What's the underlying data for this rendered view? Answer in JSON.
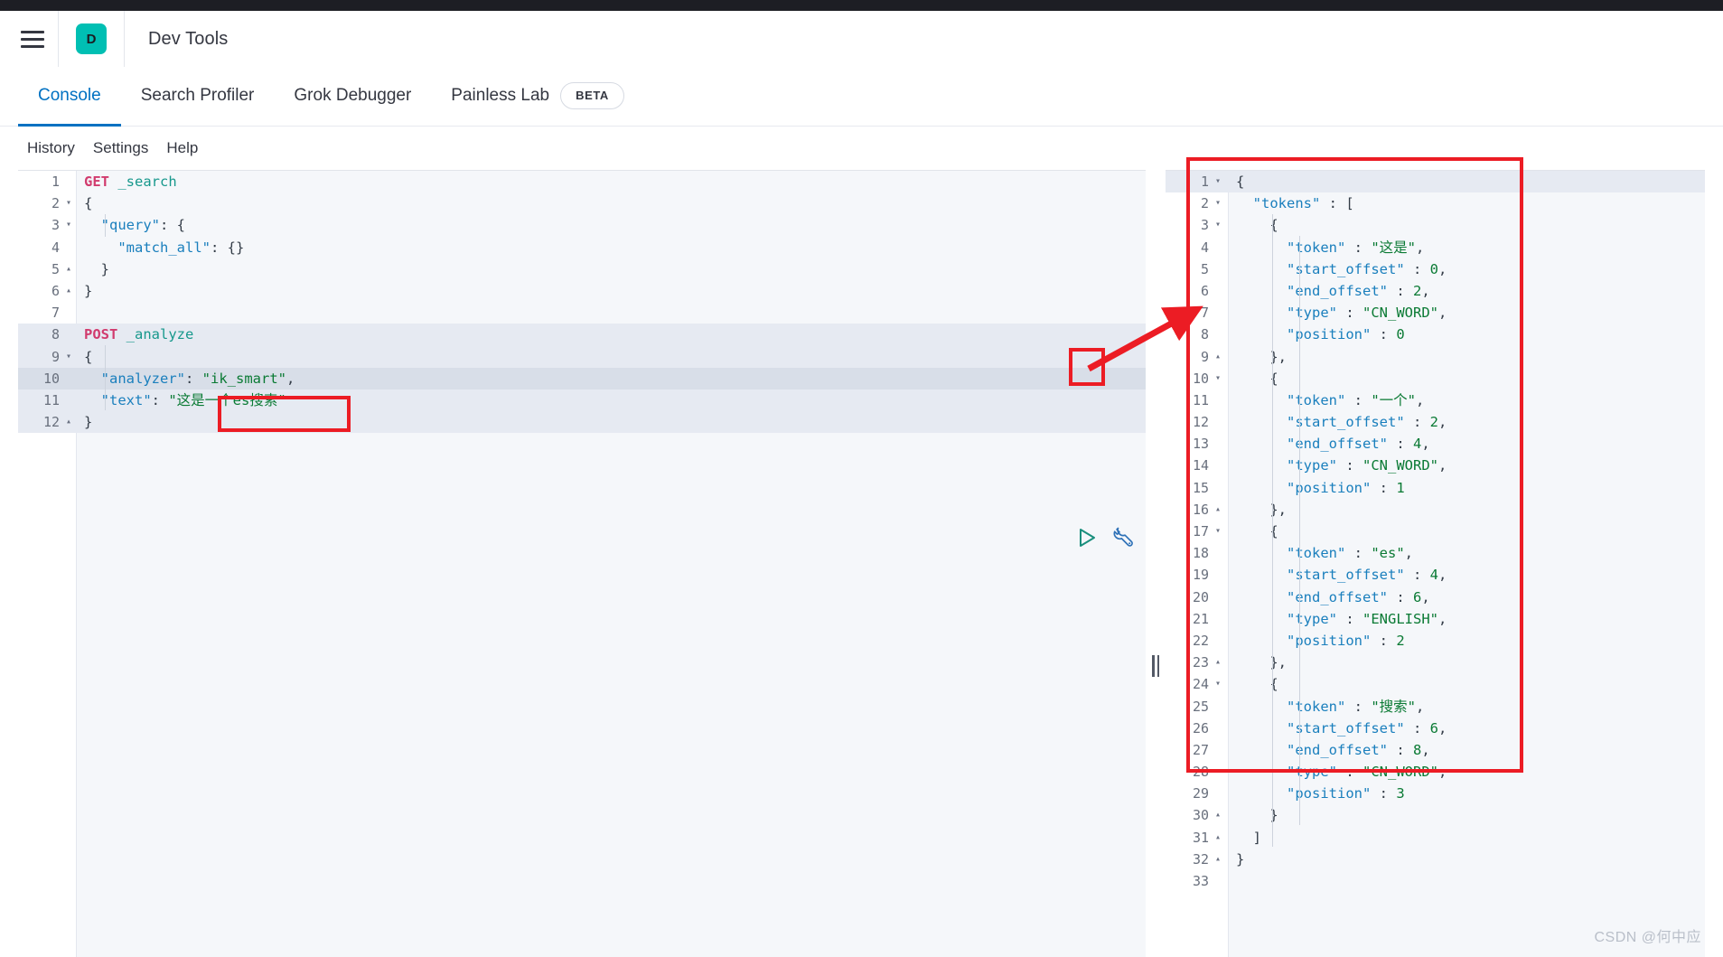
{
  "header": {
    "menu_icon": "hamburger-icon",
    "logo_letter": "D",
    "logo_color": "#00bfb3",
    "title": "Dev Tools"
  },
  "tabs": [
    {
      "label": "Console",
      "active": true
    },
    {
      "label": "Search Profiler",
      "active": false
    },
    {
      "label": "Grok Debugger",
      "active": false
    },
    {
      "label": "Painless Lab",
      "active": false,
      "badge": "BETA"
    }
  ],
  "submenu": [
    {
      "label": "History"
    },
    {
      "label": "Settings"
    },
    {
      "label": "Help"
    }
  ],
  "editor": {
    "run_icon": "play-icon",
    "wrench_icon": "wrench-icon",
    "lines": [
      {
        "n": "1",
        "fold": "",
        "selected": false,
        "current": false,
        "tokens": [
          {
            "t": "GET",
            "c": "k-method-get"
          },
          {
            "t": " ",
            "c": ""
          },
          {
            "t": "_search",
            "c": "k-url"
          }
        ]
      },
      {
        "n": "2",
        "fold": "▾",
        "selected": false,
        "current": false,
        "tokens": [
          {
            "t": "{",
            "c": "k-punct"
          }
        ]
      },
      {
        "n": "3",
        "fold": "▾",
        "selected": false,
        "current": false,
        "tokens": [
          {
            "t": "  ",
            "c": ""
          },
          {
            "t": "\"query\"",
            "c": "k-key"
          },
          {
            "t": ": {",
            "c": "k-punct"
          }
        ]
      },
      {
        "n": "4",
        "fold": "",
        "selected": false,
        "current": false,
        "tokens": [
          {
            "t": "    ",
            "c": ""
          },
          {
            "t": "\"match_all\"",
            "c": "k-key"
          },
          {
            "t": ": {}",
            "c": "k-punct"
          }
        ]
      },
      {
        "n": "5",
        "fold": "▴",
        "selected": false,
        "current": false,
        "tokens": [
          {
            "t": "  }",
            "c": "k-punct"
          }
        ]
      },
      {
        "n": "6",
        "fold": "▴",
        "selected": false,
        "current": false,
        "tokens": [
          {
            "t": "}",
            "c": "k-punct"
          }
        ]
      },
      {
        "n": "7",
        "fold": "",
        "selected": false,
        "current": false,
        "tokens": [
          {
            "t": "",
            "c": ""
          }
        ]
      },
      {
        "n": "8",
        "fold": "",
        "selected": true,
        "current": false,
        "tokens": [
          {
            "t": "POST",
            "c": "k-method-post"
          },
          {
            "t": " ",
            "c": ""
          },
          {
            "t": "_analyze",
            "c": "k-url"
          }
        ]
      },
      {
        "n": "9",
        "fold": "▾",
        "selected": true,
        "current": false,
        "tokens": [
          {
            "t": "{",
            "c": "k-punct"
          }
        ]
      },
      {
        "n": "10",
        "fold": "",
        "selected": true,
        "current": true,
        "tokens": [
          {
            "t": "  ",
            "c": ""
          },
          {
            "t": "\"analyzer\"",
            "c": "k-key"
          },
          {
            "t": ": ",
            "c": "k-punct"
          },
          {
            "t": "\"ik_smart\"",
            "c": "k-str"
          },
          {
            "t": ",",
            "c": "k-punct"
          }
        ]
      },
      {
        "n": "11",
        "fold": "",
        "selected": true,
        "current": false,
        "tokens": [
          {
            "t": "  ",
            "c": ""
          },
          {
            "t": "\"text\"",
            "c": "k-key"
          },
          {
            "t": ": ",
            "c": "k-punct"
          },
          {
            "t": "\"这是一个es搜索\"",
            "c": "k-str"
          }
        ]
      },
      {
        "n": "12",
        "fold": "▴",
        "selected": true,
        "current": false,
        "tokens": [
          {
            "t": "}",
            "c": "k-punct"
          }
        ]
      }
    ]
  },
  "output": {
    "lines": [
      {
        "n": "1",
        "fold": "▾",
        "first": true,
        "tokens": [
          {
            "t": "{",
            "c": "k-punct"
          }
        ]
      },
      {
        "n": "2",
        "fold": "▾",
        "first": false,
        "tokens": [
          {
            "t": "  ",
            "c": ""
          },
          {
            "t": "\"tokens\"",
            "c": "k-key"
          },
          {
            "t": " : [",
            "c": "k-punct"
          }
        ]
      },
      {
        "n": "3",
        "fold": "▾",
        "first": false,
        "tokens": [
          {
            "t": "    {",
            "c": "k-punct"
          }
        ]
      },
      {
        "n": "4",
        "fold": "",
        "first": false,
        "tokens": [
          {
            "t": "      ",
            "c": ""
          },
          {
            "t": "\"token\"",
            "c": "k-key"
          },
          {
            "t": " : ",
            "c": "k-punct"
          },
          {
            "t": "\"这是\"",
            "c": "k-str"
          },
          {
            "t": ",",
            "c": "k-punct"
          }
        ]
      },
      {
        "n": "5",
        "fold": "",
        "first": false,
        "tokens": [
          {
            "t": "      ",
            "c": ""
          },
          {
            "t": "\"start_offset\"",
            "c": "k-key"
          },
          {
            "t": " : ",
            "c": "k-punct"
          },
          {
            "t": "0",
            "c": "k-num"
          },
          {
            "t": ",",
            "c": "k-punct"
          }
        ]
      },
      {
        "n": "6",
        "fold": "",
        "first": false,
        "tokens": [
          {
            "t": "      ",
            "c": ""
          },
          {
            "t": "\"end_offset\"",
            "c": "k-key"
          },
          {
            "t": " : ",
            "c": "k-punct"
          },
          {
            "t": "2",
            "c": "k-num"
          },
          {
            "t": ",",
            "c": "k-punct"
          }
        ]
      },
      {
        "n": "7",
        "fold": "",
        "first": false,
        "tokens": [
          {
            "t": "      ",
            "c": ""
          },
          {
            "t": "\"type\"",
            "c": "k-key"
          },
          {
            "t": " : ",
            "c": "k-punct"
          },
          {
            "t": "\"CN_WORD\"",
            "c": "k-str"
          },
          {
            "t": ",",
            "c": "k-punct"
          }
        ]
      },
      {
        "n": "8",
        "fold": "",
        "first": false,
        "tokens": [
          {
            "t": "      ",
            "c": ""
          },
          {
            "t": "\"position\"",
            "c": "k-key"
          },
          {
            "t": " : ",
            "c": "k-punct"
          },
          {
            "t": "0",
            "c": "k-num"
          }
        ]
      },
      {
        "n": "9",
        "fold": "▴",
        "first": false,
        "tokens": [
          {
            "t": "    },",
            "c": "k-punct"
          }
        ]
      },
      {
        "n": "10",
        "fold": "▾",
        "first": false,
        "tokens": [
          {
            "t": "    {",
            "c": "k-punct"
          }
        ]
      },
      {
        "n": "11",
        "fold": "",
        "first": false,
        "tokens": [
          {
            "t": "      ",
            "c": ""
          },
          {
            "t": "\"token\"",
            "c": "k-key"
          },
          {
            "t": " : ",
            "c": "k-punct"
          },
          {
            "t": "\"一个\"",
            "c": "k-str"
          },
          {
            "t": ",",
            "c": "k-punct"
          }
        ]
      },
      {
        "n": "12",
        "fold": "",
        "first": false,
        "tokens": [
          {
            "t": "      ",
            "c": ""
          },
          {
            "t": "\"start_offset\"",
            "c": "k-key"
          },
          {
            "t": " : ",
            "c": "k-punct"
          },
          {
            "t": "2",
            "c": "k-num"
          },
          {
            "t": ",",
            "c": "k-punct"
          }
        ]
      },
      {
        "n": "13",
        "fold": "",
        "first": false,
        "tokens": [
          {
            "t": "      ",
            "c": ""
          },
          {
            "t": "\"end_offset\"",
            "c": "k-key"
          },
          {
            "t": " : ",
            "c": "k-punct"
          },
          {
            "t": "4",
            "c": "k-num"
          },
          {
            "t": ",",
            "c": "k-punct"
          }
        ]
      },
      {
        "n": "14",
        "fold": "",
        "first": false,
        "tokens": [
          {
            "t": "      ",
            "c": ""
          },
          {
            "t": "\"type\"",
            "c": "k-key"
          },
          {
            "t": " : ",
            "c": "k-punct"
          },
          {
            "t": "\"CN_WORD\"",
            "c": "k-str"
          },
          {
            "t": ",",
            "c": "k-punct"
          }
        ]
      },
      {
        "n": "15",
        "fold": "",
        "first": false,
        "tokens": [
          {
            "t": "      ",
            "c": ""
          },
          {
            "t": "\"position\"",
            "c": "k-key"
          },
          {
            "t": " : ",
            "c": "k-punct"
          },
          {
            "t": "1",
            "c": "k-num"
          }
        ]
      },
      {
        "n": "16",
        "fold": "▴",
        "first": false,
        "tokens": [
          {
            "t": "    },",
            "c": "k-punct"
          }
        ]
      },
      {
        "n": "17",
        "fold": "▾",
        "first": false,
        "tokens": [
          {
            "t": "    {",
            "c": "k-punct"
          }
        ]
      },
      {
        "n": "18",
        "fold": "",
        "first": false,
        "tokens": [
          {
            "t": "      ",
            "c": ""
          },
          {
            "t": "\"token\"",
            "c": "k-key"
          },
          {
            "t": " : ",
            "c": "k-punct"
          },
          {
            "t": "\"es\"",
            "c": "k-str"
          },
          {
            "t": ",",
            "c": "k-punct"
          }
        ]
      },
      {
        "n": "19",
        "fold": "",
        "first": false,
        "tokens": [
          {
            "t": "      ",
            "c": ""
          },
          {
            "t": "\"start_offset\"",
            "c": "k-key"
          },
          {
            "t": " : ",
            "c": "k-punct"
          },
          {
            "t": "4",
            "c": "k-num"
          },
          {
            "t": ",",
            "c": "k-punct"
          }
        ]
      },
      {
        "n": "20",
        "fold": "",
        "first": false,
        "tokens": [
          {
            "t": "      ",
            "c": ""
          },
          {
            "t": "\"end_offset\"",
            "c": "k-key"
          },
          {
            "t": " : ",
            "c": "k-punct"
          },
          {
            "t": "6",
            "c": "k-num"
          },
          {
            "t": ",",
            "c": "k-punct"
          }
        ]
      },
      {
        "n": "21",
        "fold": "",
        "first": false,
        "tokens": [
          {
            "t": "      ",
            "c": ""
          },
          {
            "t": "\"type\"",
            "c": "k-key"
          },
          {
            "t": " : ",
            "c": "k-punct"
          },
          {
            "t": "\"ENGLISH\"",
            "c": "k-str"
          },
          {
            "t": ",",
            "c": "k-punct"
          }
        ]
      },
      {
        "n": "22",
        "fold": "",
        "first": false,
        "tokens": [
          {
            "t": "      ",
            "c": ""
          },
          {
            "t": "\"position\"",
            "c": "k-key"
          },
          {
            "t": " : ",
            "c": "k-punct"
          },
          {
            "t": "2",
            "c": "k-num"
          }
        ]
      },
      {
        "n": "23",
        "fold": "▴",
        "first": false,
        "tokens": [
          {
            "t": "    },",
            "c": "k-punct"
          }
        ]
      },
      {
        "n": "24",
        "fold": "▾",
        "first": false,
        "tokens": [
          {
            "t": "    {",
            "c": "k-punct"
          }
        ]
      },
      {
        "n": "25",
        "fold": "",
        "first": false,
        "tokens": [
          {
            "t": "      ",
            "c": ""
          },
          {
            "t": "\"token\"",
            "c": "k-key"
          },
          {
            "t": " : ",
            "c": "k-punct"
          },
          {
            "t": "\"搜索\"",
            "c": "k-str"
          },
          {
            "t": ",",
            "c": "k-punct"
          }
        ]
      },
      {
        "n": "26",
        "fold": "",
        "first": false,
        "tokens": [
          {
            "t": "      ",
            "c": ""
          },
          {
            "t": "\"start_offset\"",
            "c": "k-key"
          },
          {
            "t": " : ",
            "c": "k-punct"
          },
          {
            "t": "6",
            "c": "k-num"
          },
          {
            "t": ",",
            "c": "k-punct"
          }
        ]
      },
      {
        "n": "27",
        "fold": "",
        "first": false,
        "tokens": [
          {
            "t": "      ",
            "c": ""
          },
          {
            "t": "\"end_offset\"",
            "c": "k-key"
          },
          {
            "t": " : ",
            "c": "k-punct"
          },
          {
            "t": "8",
            "c": "k-num"
          },
          {
            "t": ",",
            "c": "k-punct"
          }
        ]
      },
      {
        "n": "28",
        "fold": "",
        "first": false,
        "tokens": [
          {
            "t": "      ",
            "c": ""
          },
          {
            "t": "\"type\"",
            "c": "k-key"
          },
          {
            "t": " : ",
            "c": "k-punct"
          },
          {
            "t": "\"CN_WORD\"",
            "c": "k-str"
          },
          {
            "t": ",",
            "c": "k-punct"
          }
        ]
      },
      {
        "n": "29",
        "fold": "",
        "first": false,
        "tokens": [
          {
            "t": "      ",
            "c": ""
          },
          {
            "t": "\"position\"",
            "c": "k-key"
          },
          {
            "t": " : ",
            "c": "k-punct"
          },
          {
            "t": "3",
            "c": "k-num"
          }
        ]
      },
      {
        "n": "30",
        "fold": "▴",
        "first": false,
        "tokens": [
          {
            "t": "    }",
            "c": "k-punct"
          }
        ]
      },
      {
        "n": "31",
        "fold": "▴",
        "first": false,
        "tokens": [
          {
            "t": "  ]",
            "c": "k-punct"
          }
        ]
      },
      {
        "n": "32",
        "fold": "▴",
        "first": false,
        "tokens": [
          {
            "t": "}",
            "c": "k-punct"
          }
        ]
      },
      {
        "n": "33",
        "fold": "",
        "first": false,
        "tokens": [
          {
            "t": "",
            "c": ""
          }
        ]
      }
    ]
  },
  "annotations": {
    "accent_red": "#ec1c24",
    "ik_smart_box": true,
    "output_box": true,
    "arrow": true
  },
  "watermark": "CSDN @何中应"
}
